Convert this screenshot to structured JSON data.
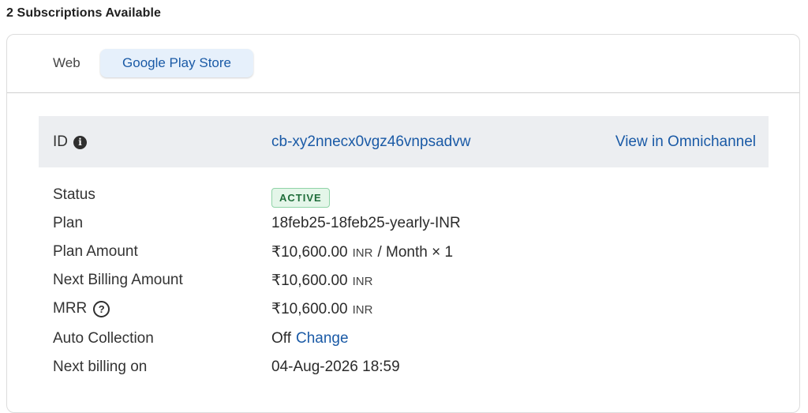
{
  "heading": "2 Subscriptions Available",
  "tabs": [
    {
      "label": "Web",
      "active": false
    },
    {
      "label": "Google Play Store",
      "active": true
    }
  ],
  "id_bar": {
    "label": "ID",
    "info_icon": "info-circle-icon",
    "value": "cb-xy2nnecx0vgz46vnpsadvw",
    "link": "View in Omnichannel"
  },
  "details": {
    "status": {
      "label": "Status",
      "value": "ACTIVE"
    },
    "plan": {
      "label": "Plan",
      "value": "18feb25-18feb25-yearly-INR"
    },
    "plan_amount": {
      "label": "Plan Amount",
      "amount": "₹10,600.00",
      "currency": "INR",
      "suffix": "/ Month × 1"
    },
    "next_billing_amount": {
      "label": "Next Billing Amount",
      "amount": "₹10,600.00",
      "currency": "INR"
    },
    "mrr": {
      "label": "MRR",
      "help_icon": "question-circle-icon",
      "amount": "₹10,600.00",
      "currency": "INR"
    },
    "auto_collection": {
      "label": "Auto Collection",
      "value": "Off",
      "action": "Change"
    },
    "next_billing_on": {
      "label": "Next billing on",
      "value": "04-Aug-2026 18:59"
    }
  },
  "colors": {
    "link": "#1a5aa6",
    "active_tab_bg": "#e6f0fb",
    "id_bar_bg": "#eceef1",
    "badge_bg": "#e4f6e9",
    "badge_text": "#1f6d3a"
  }
}
